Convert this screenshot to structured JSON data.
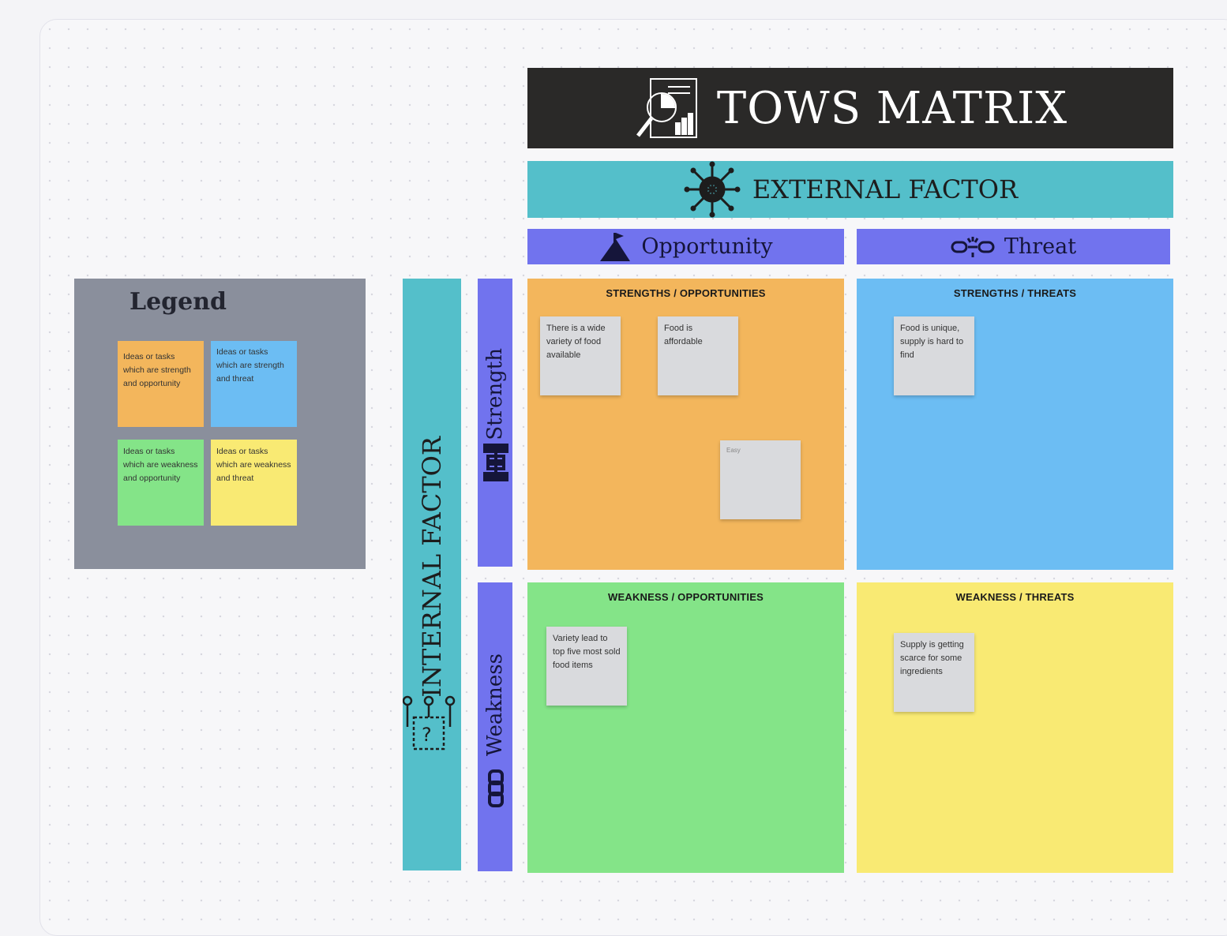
{
  "title": "TOWS MATRIX",
  "external": "EXTERNAL FACTOR",
  "internal": "INTERNAL FACTOR",
  "columns": {
    "opportunity": "Opportunity",
    "threat": "Threat"
  },
  "rows": {
    "strength": "Strength",
    "weakness": "Weakness"
  },
  "quadrants": {
    "so": {
      "title": "STRENGTHS / OPPORTUNITIES",
      "notes": [
        "There is a wide variety of food available",
        "Food is affordable",
        "Easy"
      ]
    },
    "st": {
      "title": "STRENGTHS / THREATS",
      "notes": [
        "Food is unique, supply is hard to find"
      ]
    },
    "wo": {
      "title": "WEAKNESS / OPPORTUNITIES",
      "notes": [
        "Variety lead to top five most sold food items"
      ]
    },
    "wt": {
      "title": "WEAKNESS / THREATS",
      "notes": [
        "Supply is getting scarce for some ingredients"
      ]
    }
  },
  "legend": {
    "title": "Legend",
    "items": [
      "Ideas or tasks which are strength and opportunity",
      "Ideas or tasks which are strength and threat",
      "Ideas or tasks which are weakness and opportunity",
      "Ideas or tasks which are weakness and threat"
    ]
  },
  "colors": {
    "strength_opportunity": "#f3b65c",
    "strength_threat": "#6cbdf3",
    "weakness_opportunity": "#84e488",
    "weakness_threat": "#f9ea73",
    "factor_bar": "#54bfca",
    "header_bar": "#7173ee",
    "title_bar": "#2a2928"
  },
  "icons": [
    "report-analysis-icon",
    "virus-icon",
    "mountain-flag-icon",
    "broken-chain-icon",
    "dumbbell-icon",
    "chain-icon",
    "org-chart-icon"
  ]
}
